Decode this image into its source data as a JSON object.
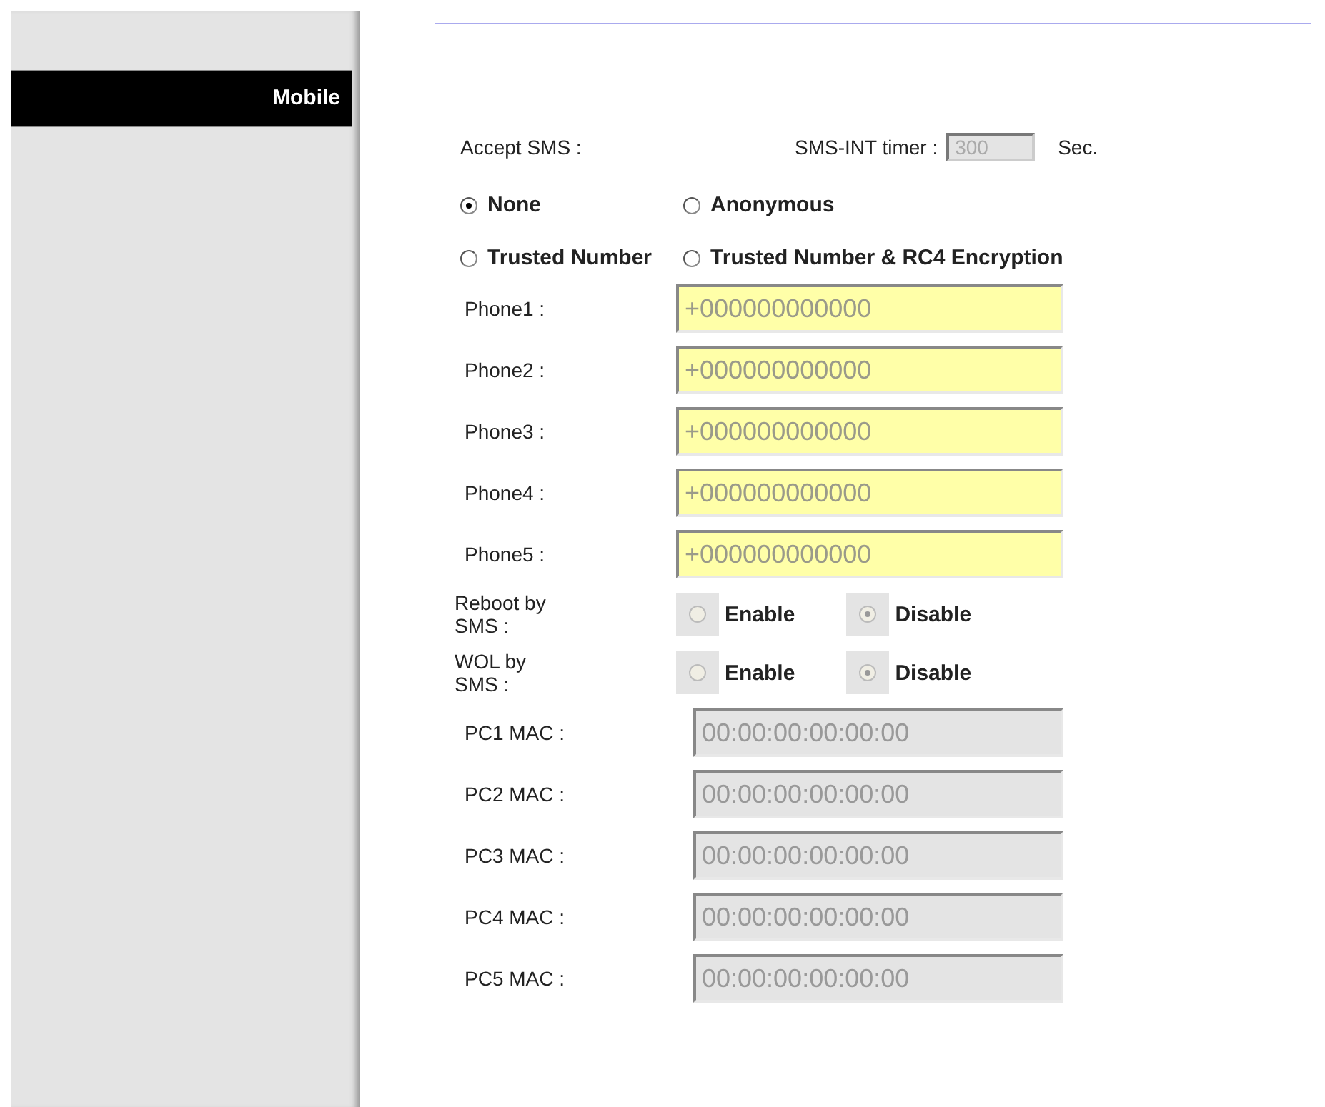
{
  "sidebar": {
    "items": [
      {
        "label": "Mobile",
        "selected": true
      }
    ]
  },
  "accept_sms": {
    "label": "Accept SMS :",
    "timer_label": "SMS-INT timer :",
    "timer_value": "300",
    "timer_disabled": true,
    "timer_unit": "Sec.",
    "options": [
      {
        "label": "None",
        "selected": true
      },
      {
        "label": "Anonymous",
        "selected": false
      },
      {
        "label": "Trusted Number",
        "selected": false
      },
      {
        "label": "Trusted Number & RC4 Encryption",
        "selected": false
      }
    ]
  },
  "phones": [
    {
      "label": "Phone1 :",
      "value": "+000000000000",
      "disabled": false
    },
    {
      "label": "Phone2 :",
      "value": "+000000000000",
      "disabled": false
    },
    {
      "label": "Phone3 :",
      "value": "+000000000000",
      "disabled": false
    },
    {
      "label": "Phone4 :",
      "value": "+000000000000",
      "disabled": false
    },
    {
      "label": "Phone5 :",
      "value": "+000000000000",
      "disabled": false
    }
  ],
  "toggles": [
    {
      "label": "Reboot by SMS :",
      "options": [
        {
          "label": "Enable",
          "selected": false
        },
        {
          "label": "Disable",
          "selected": true
        }
      ]
    },
    {
      "label": "WOL by SMS :",
      "options": [
        {
          "label": "Enable",
          "selected": false
        },
        {
          "label": "Disable",
          "selected": true
        }
      ]
    }
  ],
  "macs": [
    {
      "label": "PC1 MAC :",
      "value": "00:00:00:00:00:00",
      "disabled": true
    },
    {
      "label": "PC2 MAC :",
      "value": "00:00:00:00:00:00",
      "disabled": true
    },
    {
      "label": "PC3 MAC :",
      "value": "00:00:00:00:00:00",
      "disabled": true
    },
    {
      "label": "PC4 MAC :",
      "value": "00:00:00:00:00:00",
      "disabled": true
    },
    {
      "label": "PC5 MAC :",
      "value": "00:00:00:00:00:00",
      "disabled": true
    }
  ]
}
